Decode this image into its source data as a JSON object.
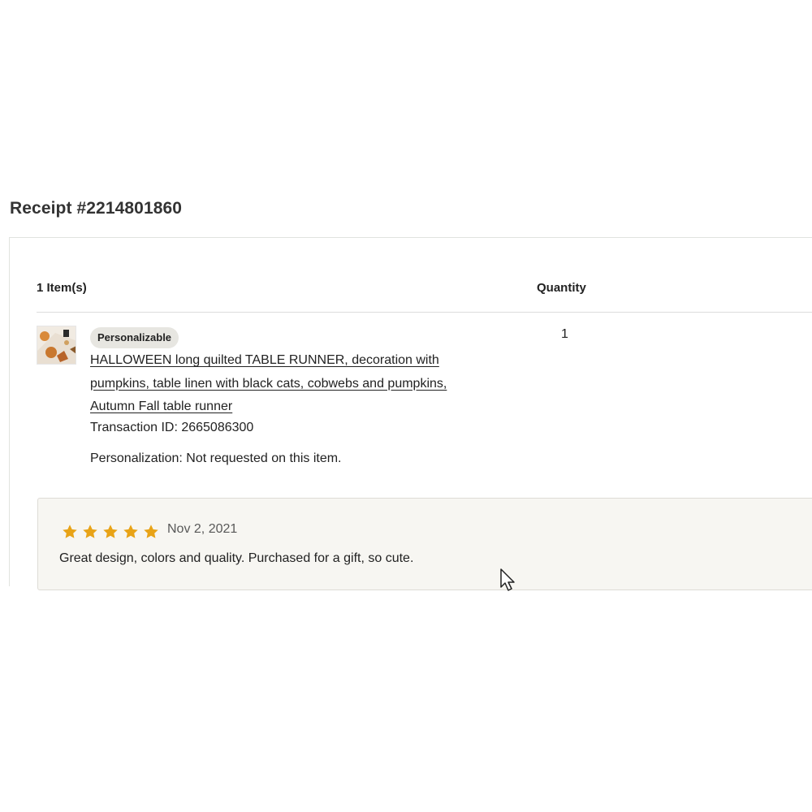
{
  "receipt": {
    "title": "Receipt #2214801860"
  },
  "table": {
    "items_header": "1 Item(s)",
    "quantity_header": "Quantity"
  },
  "item": {
    "badge": "Personalizable",
    "title": "HALLOWEEN long quilted TABLE RUNNER, decoration with pumpkins, table linen with black cats, cobwebs and pumpkins, Autumn Fall table runner",
    "transaction": "Transaction ID: 2665086300",
    "personalization": "Personalization: Not requested on this item.",
    "quantity": "1",
    "thumbnail_icon": "product-thumbnail"
  },
  "review": {
    "rating": 5,
    "rating_max": 5,
    "star_color": "#e8a317",
    "date": "Nov 2, 2021",
    "text": "Great design, colors and quality. Purchased for a gift, so cute."
  },
  "colors": {
    "review_bg": "#f7f6f2",
    "badge_bg": "#e7e6e1",
    "text": "#222222"
  }
}
